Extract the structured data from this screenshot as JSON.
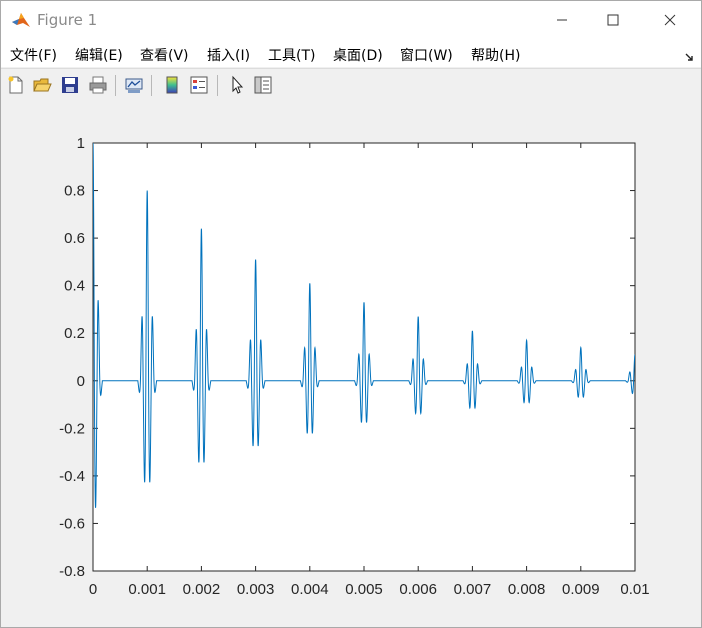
{
  "window": {
    "title": "Figure 1",
    "buttons": [
      {
        "name": "minimize",
        "icon": "minimize-icon"
      },
      {
        "name": "maximize",
        "icon": "maximize-icon"
      },
      {
        "name": "close",
        "icon": "close-icon"
      }
    ]
  },
  "menu": {
    "items": [
      "文件(F)",
      "编辑(E)",
      "查看(V)",
      "插入(I)",
      "工具(T)",
      "桌面(D)",
      "窗口(W)",
      "帮助(H)"
    ],
    "dock_icon": "dock-arrow-icon"
  },
  "toolbar": {
    "buttons": [
      {
        "name": "new-figure",
        "icon": "new-file-icon"
      },
      {
        "name": "open-file",
        "icon": "open-folder-icon"
      },
      {
        "name": "save-figure",
        "icon": "save-icon"
      },
      {
        "name": "print-figure",
        "icon": "print-icon"
      },
      {
        "name": "link-plot",
        "icon": "link-plot-icon"
      },
      {
        "name": "insert-colorbar",
        "icon": "colorbar-icon"
      },
      {
        "name": "insert-legend",
        "icon": "legend-icon"
      },
      {
        "name": "edit-plot",
        "icon": "pointer-icon"
      },
      {
        "name": "property-inspector",
        "icon": "property-inspector-icon"
      }
    ]
  },
  "chart_data": {
    "type": "line",
    "title": "",
    "xlabel": "",
    "ylabel": "",
    "xlim": [
      0,
      0.01
    ],
    "ylim": [
      -0.8,
      1
    ],
    "xticks": [
      0,
      0.001,
      0.002,
      0.003,
      0.004,
      0.005,
      0.006,
      0.007,
      0.008,
      0.009,
      0.01
    ],
    "xtick_labels": [
      "0",
      "0.001",
      "0.002",
      "0.003",
      "0.004",
      "0.005",
      "0.006",
      "0.007",
      "0.008",
      "0.009",
      "0.01"
    ],
    "yticks": [
      1,
      0.8,
      0.6,
      0.4,
      0.2,
      0,
      -0.2,
      -0.4,
      -0.6,
      -0.8
    ],
    "ytick_labels": [
      "1",
      "0.8",
      "0.6",
      "0.4",
      "0.2",
      "0",
      "-0.2",
      "-0.4",
      "-0.6",
      "-0.8"
    ],
    "grid": false,
    "line_color": "#0072bd",
    "series": [
      {
        "description": "decaying pulse train, one burst per 0.001 s",
        "burst_centers": [
          0,
          0.001,
          0.002,
          0.003,
          0.004,
          0.005,
          0.006,
          0.007,
          0.008,
          0.009,
          0.01
        ],
        "burst_peaks": [
          1.0,
          0.8,
          0.64,
          0.51,
          0.41,
          0.33,
          0.27,
          0.21,
          0.17,
          0.14,
          0.11
        ],
        "burst_troughs": [
          -0.7,
          -0.56,
          -0.45,
          -0.36,
          -0.29,
          -0.23,
          -0.18,
          -0.15,
          -0.12,
          -0.09,
          -0.07
        ]
      }
    ]
  }
}
